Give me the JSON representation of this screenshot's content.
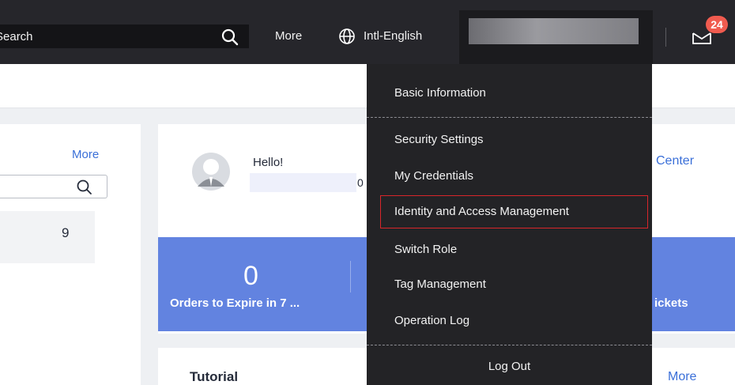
{
  "topbar": {
    "search_placeholder": "Search",
    "more_label": "More",
    "language_label": "Intl-English",
    "mail_badge_count": "24"
  },
  "icons": {
    "search": "search-icon",
    "globe": "globe-icon",
    "mail": "mail-icon",
    "avatar": "avatar-icon"
  },
  "left_card": {
    "more_label": "More",
    "stat_value": "9"
  },
  "main_card": {
    "greeting": "Hello!",
    "account_fragment": "0",
    "center_link": "Center",
    "stat_value": "0",
    "stat_label": "Orders to Expire in 7 ...",
    "tickets_label": "ickets"
  },
  "tutorial_card": {
    "title": "Tutorial",
    "more_label": "More"
  },
  "dropdown": {
    "items": [
      {
        "label": "Basic Information"
      },
      {
        "label": "Security Settings"
      },
      {
        "label": "My Credentials"
      },
      {
        "label": "Identity and Access Management"
      },
      {
        "label": "Switch Role"
      },
      {
        "label": "Tag Management"
      },
      {
        "label": "Operation Log"
      },
      {
        "label": "Log Out"
      }
    ],
    "highlighted_item": "Identity and Access Management"
  },
  "colors": {
    "topbar_bg": "#26262b",
    "dropdown_bg": "#232326",
    "accent_blue": "#6283e0",
    "link_blue": "#3a6fd8",
    "highlight_border": "#d8262a",
    "badge_red": "#f05b4f"
  }
}
